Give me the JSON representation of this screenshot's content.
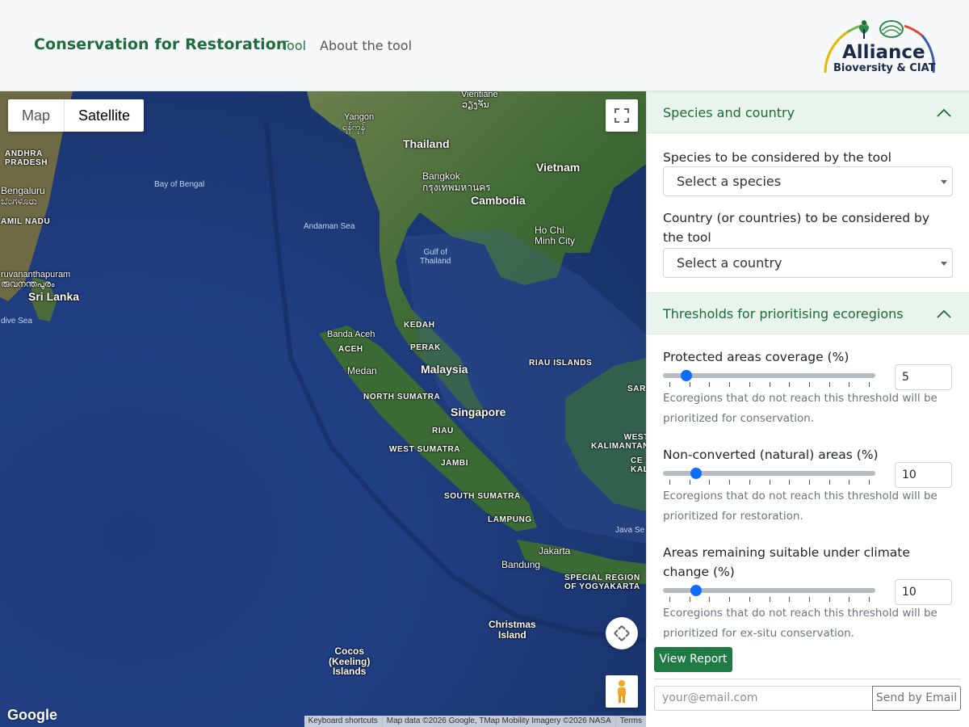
{
  "header": {
    "brand": "Conservation for Restoration",
    "nav": {
      "tool": "Tool",
      "about": "About the tool"
    },
    "logo": {
      "title": "Alliance",
      "subtitle": "Bioversity & CIAT"
    }
  },
  "map": {
    "type_buttons": {
      "map": "Map",
      "satellite": "Satellite",
      "active": "Satellite"
    },
    "labels": {
      "vientiane": "Vientiane",
      "vientiane_local": "ວຽງຈັນ",
      "yangon": "Yangon",
      "yangon_local": "ရန်ကုန်",
      "andhra": "ANDHRA\nPRADESH",
      "thailand": "Thailand",
      "vietnam": "Vietnam",
      "bay_of_bengal": "Bay of Bengal",
      "bengaluru": "Bengaluru",
      "bengaluru_local": "ಬೆಂಗಳೂರು",
      "tamil_nadu": "AMIL NADU",
      "bangkok": "Bangkok",
      "bangkok_local": "กรุงเทพมหานคร",
      "cambodia": "Cambodia",
      "andaman_sea": "Andaman Sea",
      "ho_chi_minh": "Ho Chi\nMinh City",
      "gulf_of_thailand": "Gulf of\nThailand",
      "thiruvananthapuram": "ruvananthapuram",
      "thiruvananthapuram_local": "രുവനന്തപുരം",
      "sri_lanka": "Sri Lanka",
      "maldive_sea": "dive Sea",
      "kedah": "KEDAH",
      "banda_aceh": "Banda Aceh",
      "aceh": "ACEH",
      "perak": "PERAK",
      "medan": "Medan",
      "malaysia": "Malaysia",
      "riau_islands": "RIAU ISLANDS",
      "sar": "SAR",
      "north_sumatra": "NORTH SUMATRA",
      "singapore": "Singapore",
      "riau": "RIAU",
      "west_sumatra": "WEST SUMATRA",
      "west_kalimantan": "WEST\nKALIMANTAN",
      "jambi": "JAMBI",
      "kal": "CE\nKAL",
      "south_sumatra": "SOUTH SUMATRA",
      "lampung": "LAMPUNG",
      "java_sea": "Java Se",
      "jakarta": "Jakarta",
      "bandung": "Bandung",
      "yogyakarta": "SPECIAL REGION\nOF YOGYAKARTA",
      "christmas_island": "Christmas\nIsland",
      "cocos": "Cocos\n(Keeling)\nIslands"
    },
    "google": "Google",
    "attribution": {
      "shortcuts": "Keyboard shortcuts",
      "data": "Map data ©2026 Google, TMap Mobility Imagery ©2026 NASA",
      "terms": "Terms"
    }
  },
  "panel": {
    "species_section": {
      "title": "Species and country",
      "species_label": "Species to be considered by the tool",
      "species_placeholder": "Select a species",
      "country_label": "Country (or countries) to be considered by the tool",
      "country_placeholder": "Select a country"
    },
    "thresholds_section": {
      "title": "Thresholds for prioritising ecoregions",
      "sliders": [
        {
          "label": "Protected areas coverage (%)",
          "value": "5",
          "fraction": 0.05,
          "help": "Ecoregions that do not reach this threshold will be prioritized for conservation."
        },
        {
          "label": "Non-converted (natural) areas (%)",
          "value": "10",
          "fraction": 0.1,
          "help": "Ecoregions that do not reach this threshold will be prioritized for restoration."
        },
        {
          "label": "Areas remaining suitable under climate change (%)",
          "value": "10",
          "fraction": 0.1,
          "help": "Ecoregions that do not reach this threshold will be prioritized for ex-situ conservation."
        }
      ]
    }
  },
  "footer": {
    "view_report": "View Report",
    "email_placeholder": "your@email.com",
    "send_email": "Send by Email"
  },
  "colors": {
    "brand_green": "#1f6b3e",
    "button_green": "#1f7a44",
    "accordion_bg": "#e8f4ec",
    "slider_blue": "#0d6efd"
  }
}
